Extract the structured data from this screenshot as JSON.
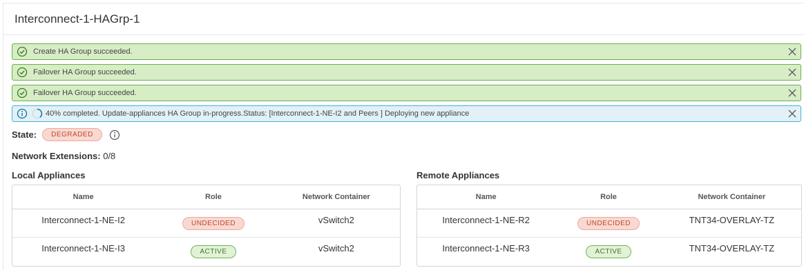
{
  "header": {
    "title": "Interconnect-1-HAGrp-1"
  },
  "alerts": [
    {
      "type": "success",
      "message": "Create HA Group succeeded."
    },
    {
      "type": "success",
      "message": "Failover HA Group succeeded."
    },
    {
      "type": "success",
      "message": "Failover HA Group succeeded."
    },
    {
      "type": "info",
      "message": "40% completed. Update-appliances HA Group in-progress.Status: [Interconnect-1-NE-I2 and Peers ] Deploying new appliance"
    }
  ],
  "progress_percent": 40,
  "state": {
    "label": "State:",
    "value": "DEGRADED"
  },
  "network_extensions": {
    "label": "Network Extensions:",
    "value": "0/8"
  },
  "local": {
    "title": "Local Appliances",
    "columns": [
      "Name",
      "Role",
      "Network Container"
    ],
    "rows": [
      {
        "name": "Interconnect-1-NE-I2",
        "role": "UNDECIDED",
        "container": "vSwitch2"
      },
      {
        "name": "Interconnect-1-NE-I3",
        "role": "ACTIVE",
        "container": "vSwitch2"
      }
    ]
  },
  "remote": {
    "title": "Remote Appliances",
    "columns": [
      "Name",
      "Role",
      "Network Container"
    ],
    "rows": [
      {
        "name": "Interconnect-1-NE-R2",
        "role": "UNDECIDED",
        "container": "TNT34-OVERLAY-TZ"
      },
      {
        "name": "Interconnect-1-NE-R3",
        "role": "ACTIVE",
        "container": "TNT34-OVERLAY-TZ"
      }
    ]
  },
  "colors": {
    "success_bg": "#d7edc6",
    "success_border": "#66b04a",
    "info_bg": "#e1f1f6",
    "info_border": "#49afd9",
    "danger": "#c24627",
    "active": "#3b7a23"
  },
  "icons": {
    "success": "check-circle-icon",
    "info": "info-circle-icon",
    "close": "close-icon",
    "progress": "spinner-icon"
  }
}
